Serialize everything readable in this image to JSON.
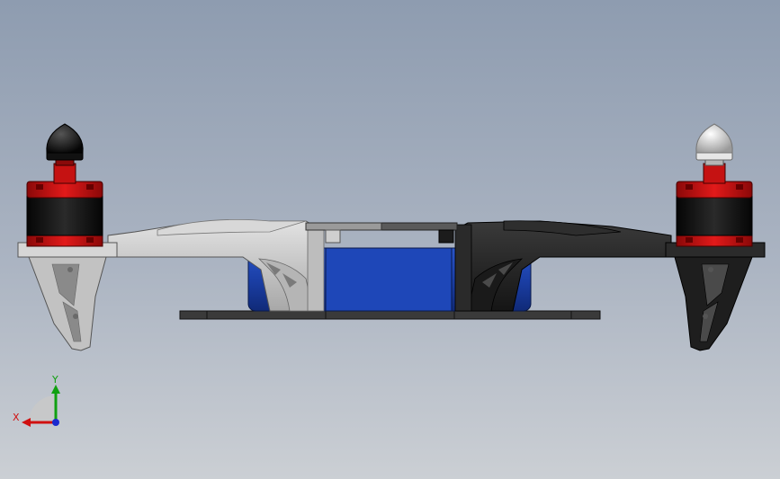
{
  "axes": {
    "x_label": "X",
    "y_label": "Y",
    "x_color": "#d01010",
    "y_color": "#10a010",
    "origin_color": "#1a2ad0"
  },
  "colors": {
    "bg_top": "#8e9cb0",
    "bg_bottom": "#c8cdd3",
    "frame_light": "#c8c8c8",
    "frame_dark": "#262626",
    "battery": "#1b3fa6",
    "motor_red": "#c80f10",
    "motor_black": "#111111",
    "prop_nut_left": "#111111",
    "prop_nut_right": "#d8d8d8"
  },
  "icons": {
    "triad": "view-orientation-triad-icon"
  }
}
